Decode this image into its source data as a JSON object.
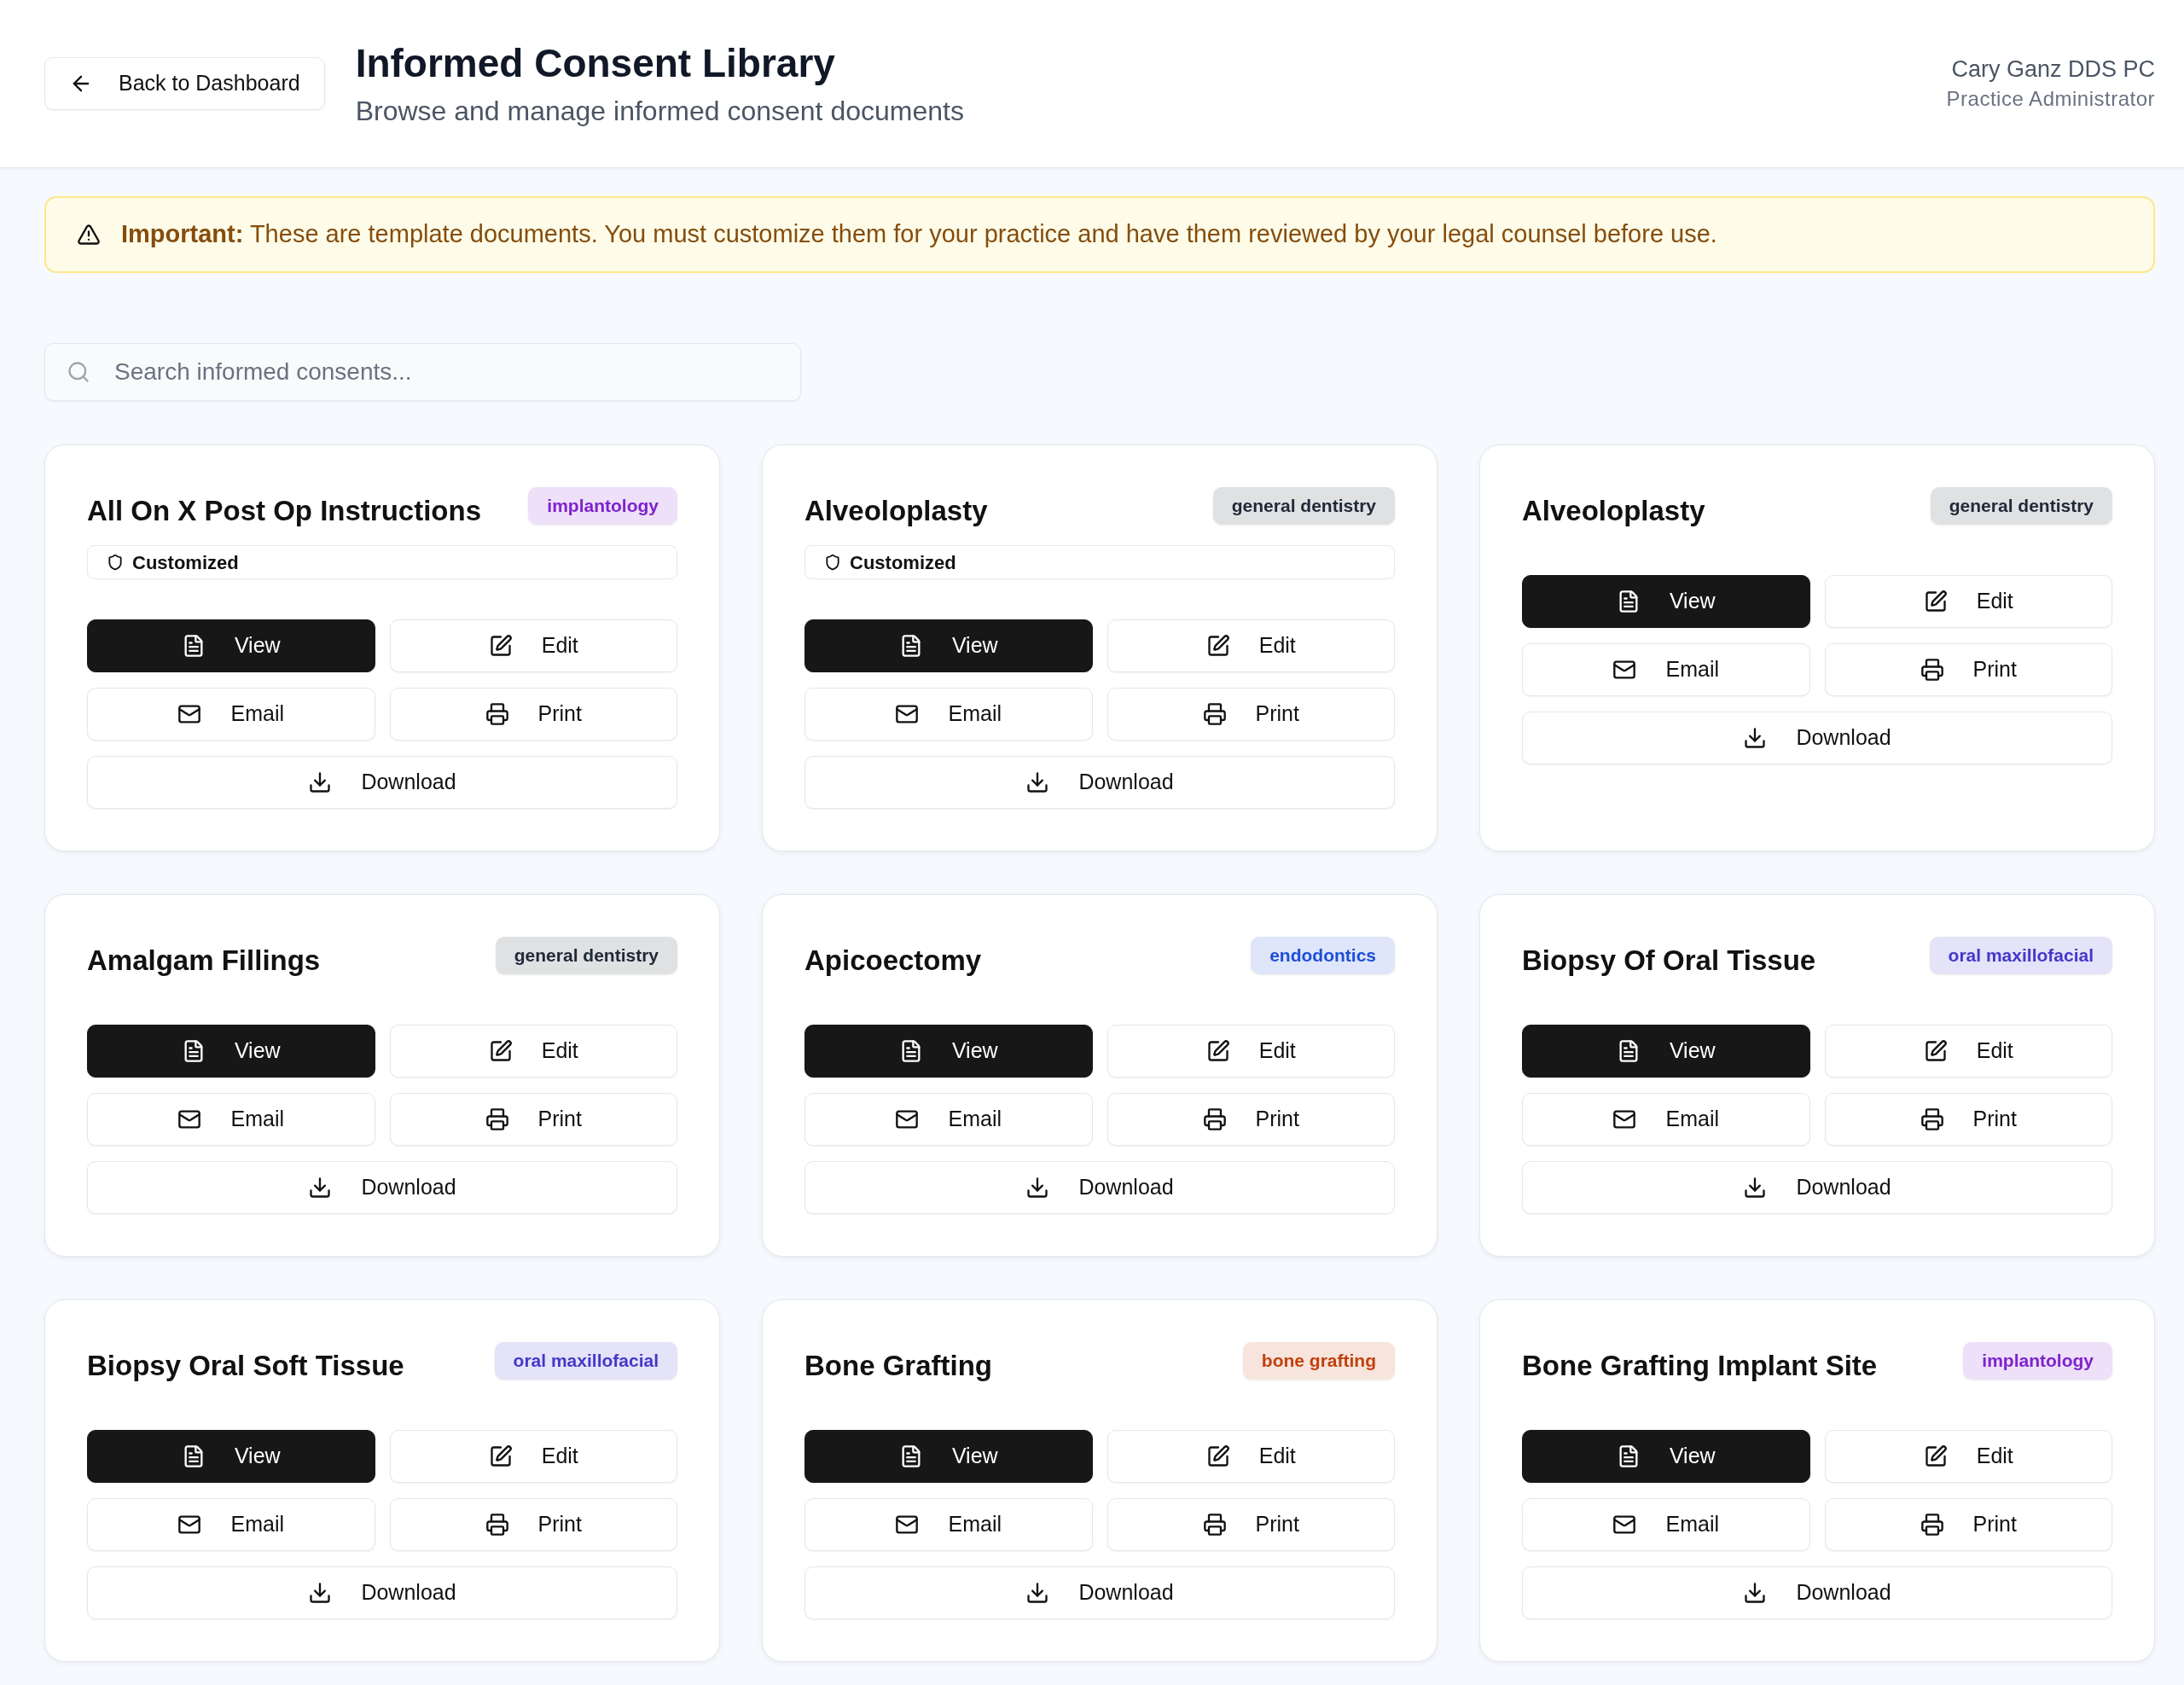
{
  "header": {
    "back_button": {
      "label": "Back to Dashboard"
    },
    "title": "Informed Consent Library",
    "subtitle": "Browse and manage informed consent documents",
    "user": {
      "name": "Cary Ganz DDS PC",
      "role": "Practice Administrator"
    }
  },
  "alert": {
    "text": "**Important:** These are template documents. You must customize them for your practice and have them reviewed by your legal counsel before use."
  },
  "search": {
    "placeholder": "Search informed consents..."
  },
  "cards": [
    {
      "title": "All On X Post Op Instructions",
      "tag": {
        "label": "implantology",
        "color": "#7e22ce"
      },
      "customized_label": "Customized",
      "actions": [
        {
          "kind": "view",
          "label": "View"
        },
        {
          "kind": "edit",
          "label": "Edit"
        },
        {
          "kind": "email",
          "label": "Email"
        },
        {
          "kind": "print",
          "label": "Print"
        },
        {
          "kind": "download",
          "label": "Download"
        }
      ]
    },
    {
      "title": "Alveoloplasty",
      "tag": {
        "label": "general dentistry",
        "color": "#1f2937"
      },
      "customized_label": "Customized",
      "actions": [
        {
          "kind": "view",
          "label": "View"
        },
        {
          "kind": "edit",
          "label": "Edit"
        },
        {
          "kind": "email",
          "label": "Email"
        },
        {
          "kind": "print",
          "label": "Print"
        },
        {
          "kind": "download",
          "label": "Download"
        }
      ]
    },
    {
      "title": "Alveoloplasty",
      "tag": {
        "label": "general dentistry",
        "color": "#1f2937"
      },
      "actions": [
        {
          "kind": "view",
          "label": "View"
        },
        {
          "kind": "edit",
          "label": "Edit"
        },
        {
          "kind": "email",
          "label": "Email"
        },
        {
          "kind": "print",
          "label": "Print"
        },
        {
          "kind": "download",
          "label": "Download"
        }
      ]
    },
    {
      "title": "Amalgam Fillings",
      "tag": {
        "label": "general dentistry",
        "color": "#1f2937"
      },
      "actions": [
        {
          "kind": "view",
          "label": "View"
        },
        {
          "kind": "edit",
          "label": "Edit"
        },
        {
          "kind": "email",
          "label": "Email"
        },
        {
          "kind": "print",
          "label": "Print"
        },
        {
          "kind": "download",
          "label": "Download"
        }
      ]
    },
    {
      "title": "Apicoectomy",
      "tag": {
        "label": "endodontics",
        "color": "#1d4ed8"
      },
      "actions": [
        {
          "kind": "view",
          "label": "View"
        },
        {
          "kind": "edit",
          "label": "Edit"
        },
        {
          "kind": "email",
          "label": "Email"
        },
        {
          "kind": "print",
          "label": "Print"
        },
        {
          "kind": "download",
          "label": "Download"
        }
      ]
    },
    {
      "title": "Biopsy Of Oral Tissue",
      "tag": {
        "label": "oral maxillofacial",
        "color": "#4338ca"
      },
      "actions": [
        {
          "kind": "view",
          "label": "View"
        },
        {
          "kind": "edit",
          "label": "Edit"
        },
        {
          "kind": "email",
          "label": "Email"
        },
        {
          "kind": "print",
          "label": "Print"
        },
        {
          "kind": "download",
          "label": "Download"
        }
      ]
    },
    {
      "title": "Biopsy Oral Soft Tissue",
      "tag": {
        "label": "oral maxillofacial",
        "color": "#4338ca"
      },
      "actions": [
        {
          "kind": "view",
          "label": "View"
        },
        {
          "kind": "edit",
          "label": "Edit"
        },
        {
          "kind": "email",
          "label": "Email"
        },
        {
          "kind": "print",
          "label": "Print"
        },
        {
          "kind": "download",
          "label": "Download"
        }
      ]
    },
    {
      "title": "Bone Grafting",
      "tag": {
        "label": "bone grafting",
        "color": "#c2410c"
      },
      "actions": [
        {
          "kind": "view",
          "label": "View"
        },
        {
          "kind": "edit",
          "label": "Edit"
        },
        {
          "kind": "email",
          "label": "Email"
        },
        {
          "kind": "print",
          "label": "Print"
        },
        {
          "kind": "download",
          "label": "Download"
        }
      ]
    },
    {
      "title": "Bone Grafting Implant Site",
      "tag": {
        "label": "implantology",
        "color": "#7e22ce"
      },
      "actions": [
        {
          "kind": "view",
          "label": "View"
        },
        {
          "kind": "edit",
          "label": "Edit"
        },
        {
          "kind": "email",
          "label": "Email"
        },
        {
          "kind": "print",
          "label": "Print"
        },
        {
          "kind": "download",
          "label": "Download"
        }
      ]
    }
  ]
}
